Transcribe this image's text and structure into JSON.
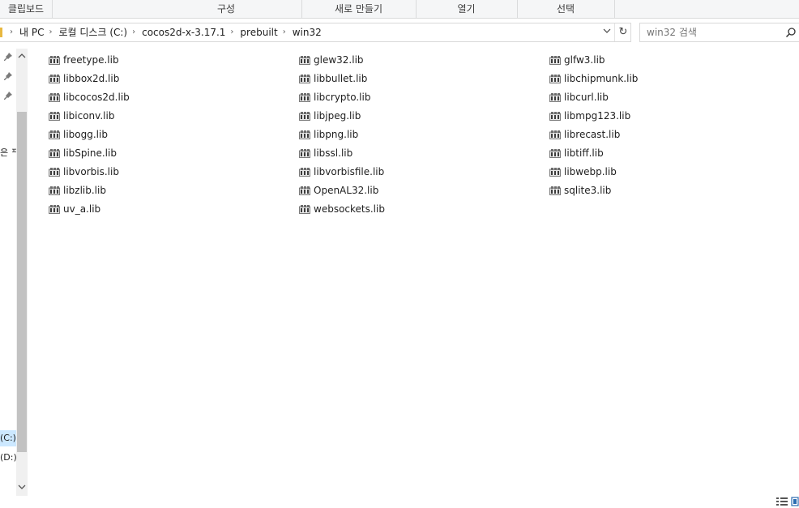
{
  "ribbon": {
    "groups": [
      "클립보드",
      "구성",
      "새로 만들기",
      "열기",
      "선택"
    ]
  },
  "address": {
    "crumbs": [
      "내 PC",
      "로컬 디스크 (C:)",
      "cocos2d-x-3.17.1",
      "prebuilt",
      "win32"
    ],
    "dropdown_glyph": "⌄",
    "refresh_glyph": "↻"
  },
  "search": {
    "placeholder": "win32 검색"
  },
  "nav": {
    "labels": [
      "은 ᄑ",
      "(C:)",
      "(D:)"
    ]
  },
  "files": {
    "col1": [
      "freetype.lib",
      "libbox2d.lib",
      "libcocos2d.lib",
      "libiconv.lib",
      "libogg.lib",
      "libSpine.lib",
      "libvorbis.lib",
      "libzlib.lib",
      "uv_a.lib"
    ],
    "col2": [
      "glew32.lib",
      "libbullet.lib",
      "libcrypto.lib",
      "libjpeg.lib",
      "libpng.lib",
      "libssl.lib",
      "libvorbisfile.lib",
      "OpenAL32.lib",
      "websockets.lib"
    ],
    "col3": [
      "glfw3.lib",
      "libchipmunk.lib",
      "libcurl.lib",
      "libmpg123.lib",
      "librecast.lib",
      "libtiff.lib",
      "libwebp.lib",
      "sqlite3.lib"
    ]
  },
  "icons": {
    "file": "library-file-icon",
    "pin": "pin-icon",
    "search": "search-icon",
    "details_view": "details-view-icon",
    "large_icons_view": "large-icons-view-icon"
  },
  "colors": {
    "selection": "#cce8ff",
    "folder": "#e8b840"
  }
}
